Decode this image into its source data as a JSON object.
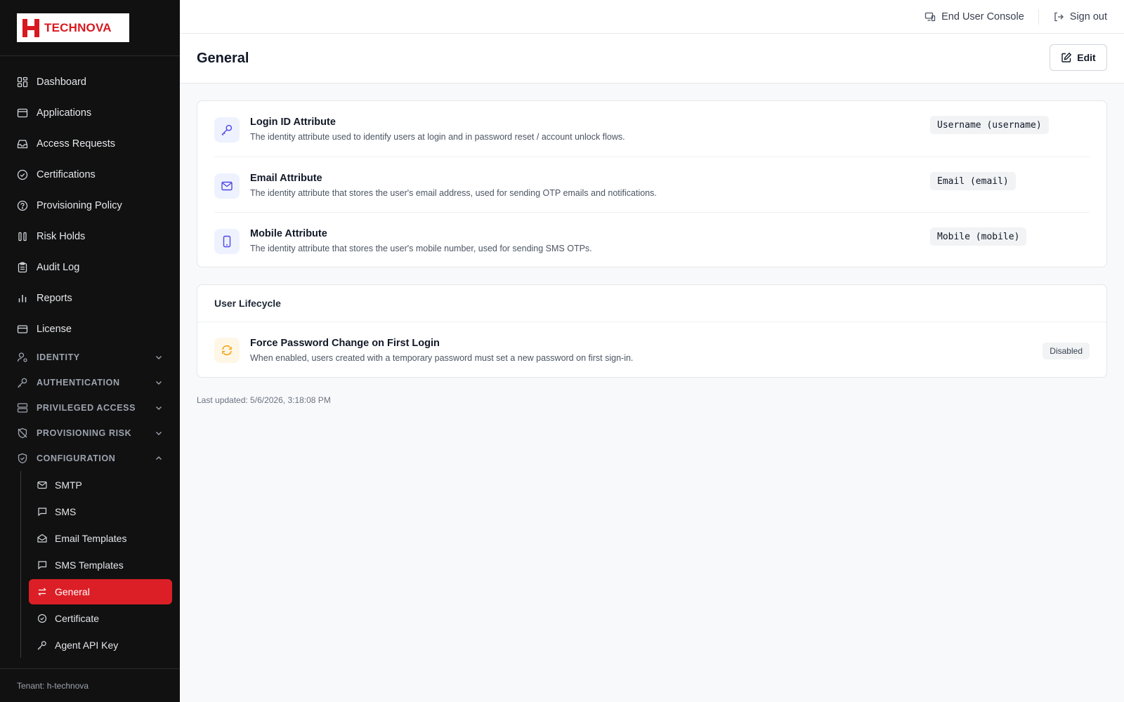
{
  "brand": {
    "name": "TECHNOVA"
  },
  "topbar": {
    "end_user_console": "End User Console",
    "sign_out": "Sign out"
  },
  "nav": {
    "items": [
      {
        "label": "Dashboard",
        "icon": "dashboard-icon"
      },
      {
        "label": "Applications",
        "icon": "window-icon"
      },
      {
        "label": "Access Requests",
        "icon": "inbox-icon"
      },
      {
        "label": "Certifications",
        "icon": "check-circle-icon"
      },
      {
        "label": "Provisioning Policy",
        "icon": "policy-icon"
      },
      {
        "label": "Risk Holds",
        "icon": "pause-icon"
      },
      {
        "label": "Audit Log",
        "icon": "clipboard-icon"
      },
      {
        "label": "Reports",
        "icon": "bar-chart-icon"
      },
      {
        "label": "License",
        "icon": "card-icon"
      }
    ],
    "sections": [
      {
        "label": "IDENTITY",
        "icon": "user-gear-icon",
        "expanded": false
      },
      {
        "label": "AUTHENTICATION",
        "icon": "key-icon",
        "expanded": false
      },
      {
        "label": "PRIVILEGED ACCESS",
        "icon": "server-icon",
        "expanded": false
      },
      {
        "label": "PROVISIONING RISK",
        "icon": "shield-off-icon",
        "expanded": false
      },
      {
        "label": "CONFIGURATION",
        "icon": "shield-check-icon",
        "expanded": true
      }
    ],
    "config_items": [
      {
        "label": "SMTP",
        "icon": "mail-icon"
      },
      {
        "label": "SMS",
        "icon": "message-icon"
      },
      {
        "label": "Email Templates",
        "icon": "mail-open-icon"
      },
      {
        "label": "SMS Templates",
        "icon": "message-icon"
      },
      {
        "label": "General",
        "icon": "arrows-exchange-icon",
        "active": true
      },
      {
        "label": "Certificate",
        "icon": "check-circle-icon"
      },
      {
        "label": "Agent API Key",
        "icon": "key-icon"
      }
    ]
  },
  "tenant": "Tenant: h-technova",
  "page": {
    "title": "General",
    "edit_label": "Edit"
  },
  "attributes": [
    {
      "title": "Login ID Attribute",
      "desc": "The identity attribute used to identify users at login and in password reset / account unlock flows.",
      "value": "Username (username)",
      "icon": "key-icon"
    },
    {
      "title": "Email Attribute",
      "desc": "The identity attribute that stores the user's email address, used for sending OTP emails and notifications.",
      "value": "Email (email)",
      "icon": "mail-icon"
    },
    {
      "title": "Mobile Attribute",
      "desc": "The identity attribute that stores the user's mobile number, used for sending SMS OTPs.",
      "value": "Mobile (mobile)",
      "icon": "smartphone-icon"
    }
  ],
  "lifecycle": {
    "heading": "User Lifecycle",
    "item": {
      "title": "Force Password Change on First Login",
      "desc": "When enabled, users created with a temporary password must set a new password on first sign-in.",
      "status": "Disabled",
      "icon": "refresh-icon"
    }
  },
  "last_updated": "Last updated: 5/6/2026, 3:18:08 PM",
  "colors": {
    "accent": "#dc1f26",
    "sidebar_bg": "#111111",
    "icon_tint": "#4f46e5",
    "lifecycle_icon": "#f59e0b"
  }
}
